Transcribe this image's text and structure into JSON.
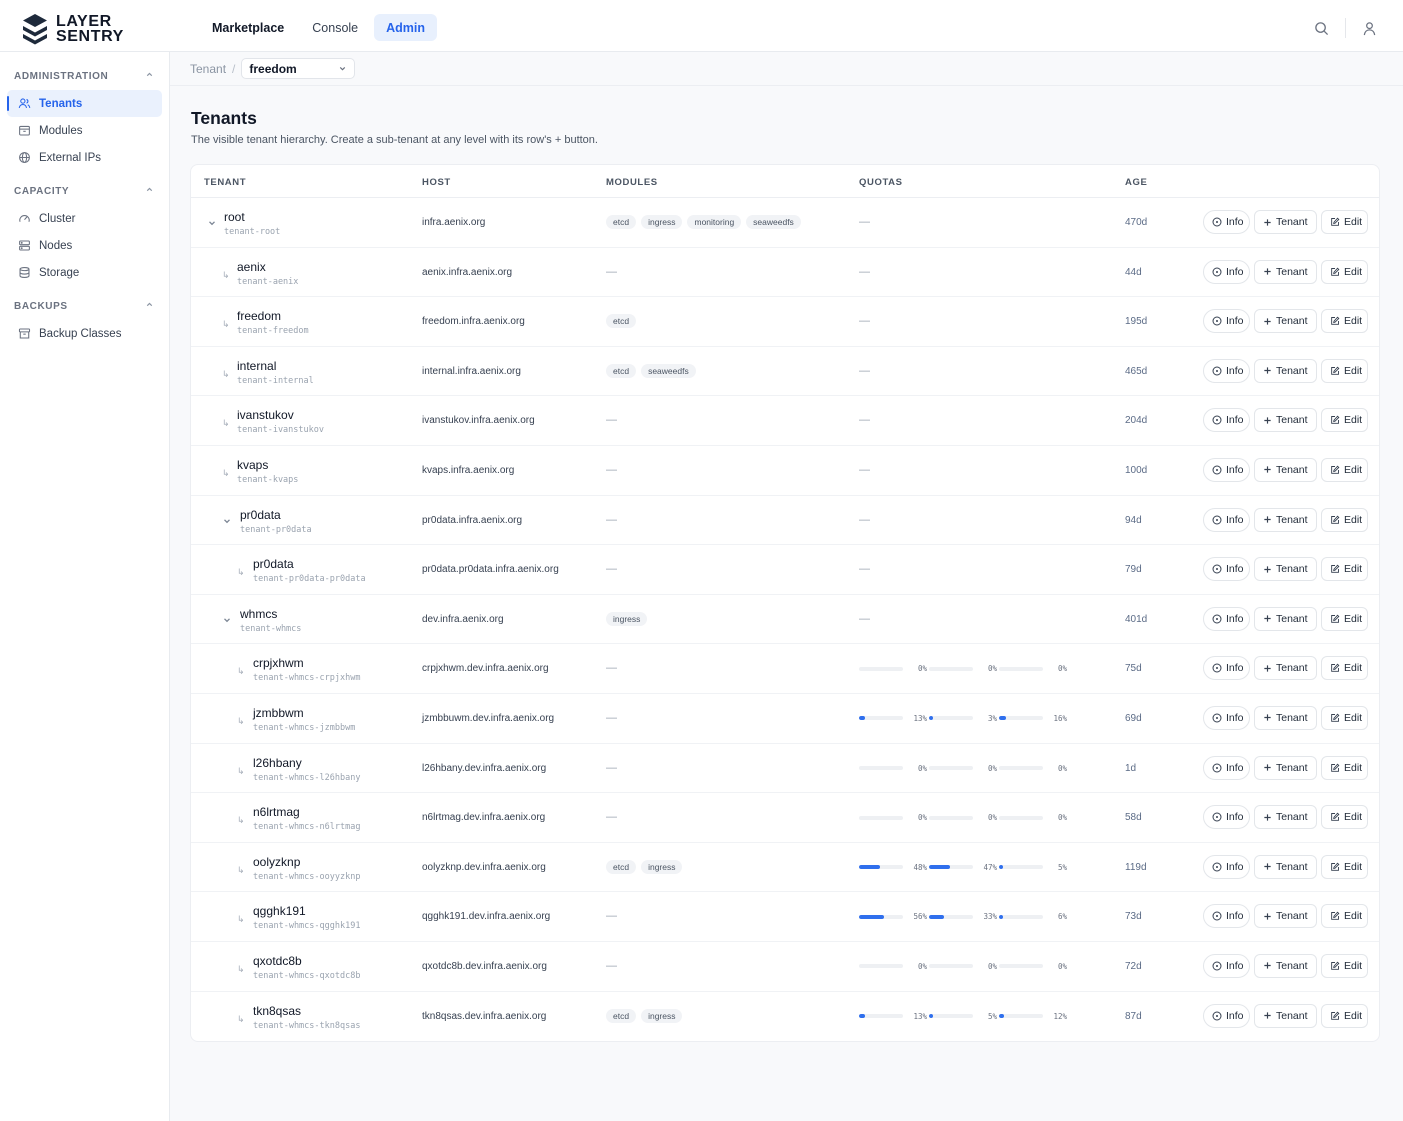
{
  "brand": {
    "line1": "LAYER",
    "line2": "SENTRY"
  },
  "topnav": [
    {
      "label": "Marketplace",
      "active": false
    },
    {
      "label": "Console",
      "active": false
    },
    {
      "label": "Admin",
      "active": true
    }
  ],
  "top_icons": [
    "search-icon",
    "user-icon"
  ],
  "sidebar": {
    "sections": [
      {
        "title": "ADMINISTRATION",
        "items": [
          {
            "label": "Tenants",
            "icon": "users-icon",
            "active": true
          },
          {
            "label": "Modules",
            "icon": "package-icon",
            "active": false
          },
          {
            "label": "External IPs",
            "icon": "globe-icon",
            "active": false
          }
        ]
      },
      {
        "title": "CAPACITY",
        "items": [
          {
            "label": "Cluster",
            "icon": "gauge-icon",
            "active": false
          },
          {
            "label": "Nodes",
            "icon": "server-icon",
            "active": false
          },
          {
            "label": "Storage",
            "icon": "database-icon",
            "active": false
          }
        ]
      },
      {
        "title": "BACKUPS",
        "items": [
          {
            "label": "Backup Classes",
            "icon": "archive-icon",
            "active": false
          }
        ]
      }
    ]
  },
  "breadcrumb": {
    "root": "Tenant",
    "separator": "/",
    "selected": "freedom"
  },
  "page": {
    "title": "Tenants",
    "subtitle": "The visible tenant hierarchy. Create a sub-tenant at any level with its row's + button."
  },
  "table": {
    "columns": {
      "tenant": "TENANT",
      "host": "HOST",
      "modules": "MODULES",
      "quotas": "QUOTAS",
      "age": "AGE"
    },
    "actions": {
      "info": "Info",
      "tenant": "Tenant",
      "edit": "Edit"
    },
    "dash": "—",
    "rows": [
      {
        "name": "root",
        "slug": "tenant-root",
        "depth": 0,
        "expanded": true,
        "host": "infra.aenix.org",
        "modules": [
          "etcd",
          "ingress",
          "monitoring",
          "seaweedfs"
        ],
        "quotas": null,
        "age": "470d"
      },
      {
        "name": "aenix",
        "slug": "tenant-aenix",
        "depth": 1,
        "host": "aenix.infra.aenix.org",
        "modules": [],
        "quotas": null,
        "age": "44d"
      },
      {
        "name": "freedom",
        "slug": "tenant-freedom",
        "depth": 1,
        "host": "freedom.infra.aenix.org",
        "modules": [
          "etcd"
        ],
        "quotas": null,
        "age": "195d"
      },
      {
        "name": "internal",
        "slug": "tenant-internal",
        "depth": 1,
        "host": "internal.infra.aenix.org",
        "modules": [
          "etcd",
          "seaweedfs"
        ],
        "quotas": null,
        "age": "465d"
      },
      {
        "name": "ivanstukov",
        "slug": "tenant-ivanstukov",
        "depth": 1,
        "host": "ivanstukov.infra.aenix.org",
        "modules": [],
        "quotas": null,
        "age": "204d"
      },
      {
        "name": "kvaps",
        "slug": "tenant-kvaps",
        "depth": 1,
        "host": "kvaps.infra.aenix.org",
        "modules": [],
        "quotas": null,
        "age": "100d"
      },
      {
        "name": "pr0data",
        "slug": "tenant-pr0data",
        "depth": 1,
        "expanded": true,
        "host": "pr0data.infra.aenix.org",
        "modules": [],
        "quotas": null,
        "age": "94d"
      },
      {
        "name": "pr0data",
        "slug": "tenant-pr0data-pr0data",
        "depth": 2,
        "host": "pr0data.pr0data.infra.aenix.org",
        "modules": [],
        "quotas": null,
        "age": "79d"
      },
      {
        "name": "whmcs",
        "slug": "tenant-whmcs",
        "depth": 1,
        "expanded": true,
        "host": "dev.infra.aenix.org",
        "modules": [
          "ingress"
        ],
        "quotas": null,
        "age": "401d"
      },
      {
        "name": "crpjxhwm",
        "slug": "tenant-whmcs-crpjxhwm",
        "depth": 2,
        "host": "crpjxhwm.dev.infra.aenix.org",
        "modules": [],
        "quotas": [
          0,
          0,
          0
        ],
        "age": "75d"
      },
      {
        "name": "jzmbbwm",
        "slug": "tenant-whmcs-jzmbbwm",
        "depth": 2,
        "host": "jzmbbuwm.dev.infra.aenix.org",
        "modules": [],
        "quotas": [
          13,
          3,
          16
        ],
        "age": "69d"
      },
      {
        "name": "l26hbany",
        "slug": "tenant-whmcs-l26hbany",
        "depth": 2,
        "host": "l26hbany.dev.infra.aenix.org",
        "modules": [],
        "quotas": [
          0,
          0,
          0
        ],
        "age": "1d"
      },
      {
        "name": "n6lrtmag",
        "slug": "tenant-whmcs-n6lrtmag",
        "depth": 2,
        "host": "n6lrtmag.dev.infra.aenix.org",
        "modules": [],
        "quotas": [
          0,
          0,
          0
        ],
        "age": "58d"
      },
      {
        "name": "oolyzknp",
        "slug": "tenant-whmcs-ooyyzknp",
        "depth": 2,
        "host": "oolyzknp.dev.infra.aenix.org",
        "modules": [
          "etcd",
          "ingress"
        ],
        "quotas": [
          48,
          47,
          5
        ],
        "age": "119d"
      },
      {
        "name": "qgghk191",
        "slug": "tenant-whmcs-qgghk191",
        "depth": 2,
        "host": "qgghk191.dev.infra.aenix.org",
        "modules": [],
        "quotas": [
          56,
          33,
          6
        ],
        "age": "73d"
      },
      {
        "name": "qxotdc8b",
        "slug": "tenant-whmcs-qxotdc8b",
        "depth": 2,
        "host": "qxotdc8b.dev.infra.aenix.org",
        "modules": [],
        "quotas": [
          0,
          0,
          0
        ],
        "age": "72d"
      },
      {
        "name": "tkn8qsas",
        "slug": "tenant-whmcs-tkn8qsas",
        "depth": 2,
        "host": "tkn8qsas.dev.infra.aenix.org",
        "modules": [
          "etcd",
          "ingress"
        ],
        "quotas": [
          13,
          5,
          12
        ],
        "age": "87d"
      }
    ]
  },
  "colors": {
    "accent": "#2563eb",
    "accent_bg": "#eaf1fd",
    "quota_fill": "#2f6fed"
  }
}
